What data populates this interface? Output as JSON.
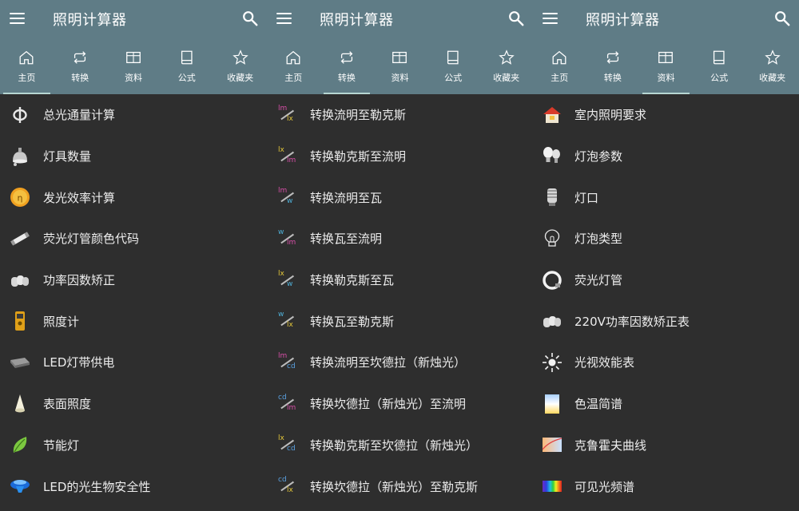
{
  "app_title": "照明计算器",
  "tabs": [
    "主页",
    "转换",
    "资料",
    "公式",
    "收藏夹"
  ],
  "colors": {
    "appbar": "#5f7c86",
    "background": "#2e2e2e",
    "tab_indicator": "#b7d6d2",
    "lm": "#d84fa8",
    "lx": "#e3c63a",
    "w": "#4fb0d8",
    "cd": "#5aa0e0"
  },
  "panel1": {
    "active_tab": 0,
    "items": [
      {
        "label": "总光通量计算",
        "icon": "phi-icon"
      },
      {
        "label": "灯具数量",
        "icon": "luminaire-icon"
      },
      {
        "label": "发光效率计算",
        "icon": "efficacy-icon"
      },
      {
        "label": "荧光灯管颜色代码",
        "icon": "fluorescent-tube-icon"
      },
      {
        "label": "功率因数矫正",
        "icon": "capacitor-icon"
      },
      {
        "label": "照度计",
        "icon": "lux-meter-icon"
      },
      {
        "label": "LED灯带供电",
        "icon": "led-strip-icon"
      },
      {
        "label": "表面照度",
        "icon": "cone-icon"
      },
      {
        "label": "节能灯",
        "icon": "leaf-icon"
      },
      {
        "label": "LED的光生物安全性",
        "icon": "led-bulb-icon"
      }
    ]
  },
  "panel2": {
    "active_tab": 1,
    "items": [
      {
        "label": "转换流明至勒克斯",
        "from": "lm",
        "to": "lx"
      },
      {
        "label": "转换勒克斯至流明",
        "from": "lx",
        "to": "lm"
      },
      {
        "label": "转换流明至瓦",
        "from": "lm",
        "to": "w"
      },
      {
        "label": "转换瓦至流明",
        "from": "w",
        "to": "lm"
      },
      {
        "label": "转换勒克斯至瓦",
        "from": "lx",
        "to": "w"
      },
      {
        "label": "转换瓦至勒克斯",
        "from": "w",
        "to": "lx"
      },
      {
        "label": "转换流明至坎德拉（新烛光）",
        "from": "lm",
        "to": "cd"
      },
      {
        "label": "转换坎德拉（新烛光）至流明",
        "from": "cd",
        "to": "lm"
      },
      {
        "label": "转换勒克斯至坎德拉（新烛光）",
        "from": "lx",
        "to": "cd"
      },
      {
        "label": "转换坎德拉（新烛光）至勒克斯",
        "from": "cd",
        "to": "lx"
      }
    ]
  },
  "panel3": {
    "active_tab": 2,
    "items": [
      {
        "label": "室内照明要求",
        "icon": "house-icon"
      },
      {
        "label": "灯泡参数",
        "icon": "bulbs-icon"
      },
      {
        "label": "灯口",
        "icon": "socket-icon"
      },
      {
        "label": "灯泡类型",
        "icon": "bulb-outline-icon"
      },
      {
        "label": "荧光灯管",
        "icon": "circular-tube-icon"
      },
      {
        "label": "220V功率因数矫正表",
        "icon": "capacitor-icon"
      },
      {
        "label": "光视效能表",
        "icon": "sun-icon"
      },
      {
        "label": "色温简谱",
        "icon": "color-temperature-icon"
      },
      {
        "label": "克鲁霍夫曲线",
        "icon": "kruithof-curve-icon"
      },
      {
        "label": "可见光频谱",
        "icon": "spectrum-icon"
      }
    ]
  }
}
